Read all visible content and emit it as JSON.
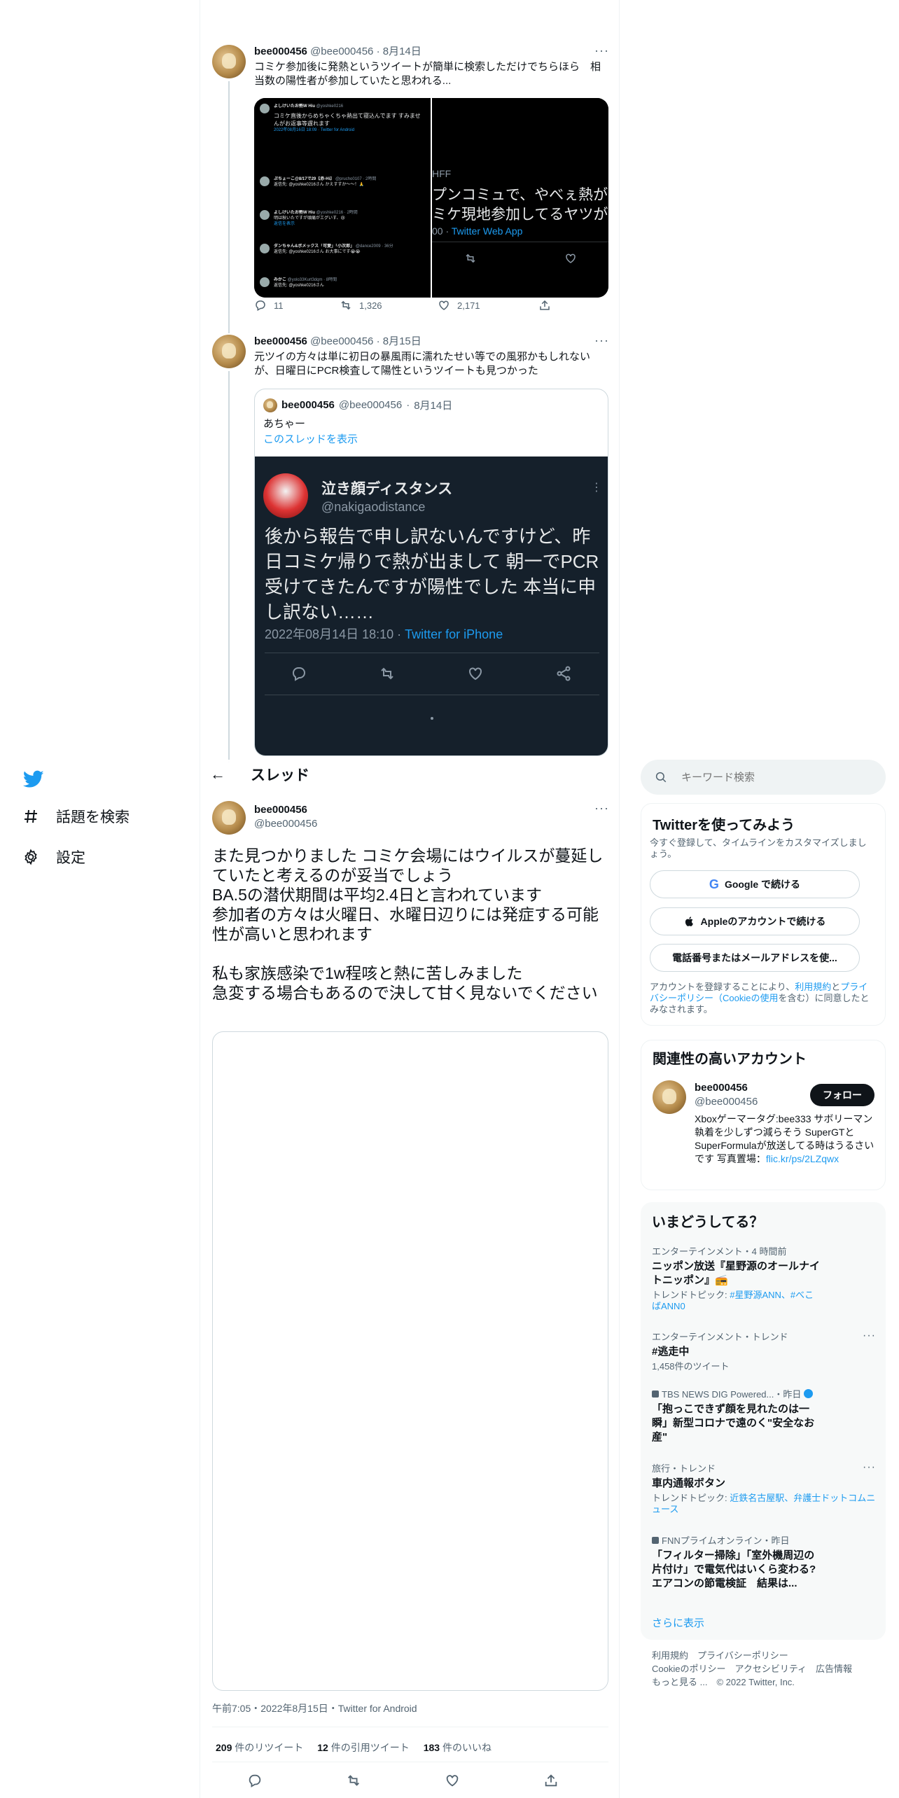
{
  "nav": {
    "explore_label": "話題を検索",
    "settings_label": "設定"
  },
  "header": {
    "back": "←",
    "title": "スレッド"
  },
  "tweets": [
    {
      "name": "bee000456",
      "handle": "@bee000456",
      "date": "8月14日",
      "text": "コミケ参加後に発熱というツイートが簡単に検索しただけでちらほら　相当数の陽性者が参加していたと思われる...",
      "replies": "11",
      "retweets": "1,326",
      "likes": "2,171",
      "media": {
        "left": {
          "rows": [
            {
              "name": "よしけいたお熱W Hiu",
              "handle": "@yoshke0216",
              "text": "コミケ直後からめちゃくちゃ熱出て寝込んでます すみませんがお返事等遅れます",
              "time": "2022年08月16日 18:09 · Twitter for Android"
            },
            {
              "name": "ぷちょーこ@8/17で29【赤-Hi】",
              "handle": "@prucho0107 · 2時間",
              "text": "返信先: @yoshke0216さん かえすすか〜〜！🙏",
              "time": ""
            },
            {
              "name": "よしけいたお熱W Hiu",
              "handle": "@yoshke0216 · 2時間",
              "text": "明は秋いたですが頭痛がエグいす、😢",
              "time": "返信を表示"
            },
            {
              "name": "ダンちゃん&ボメックス「可愛」「小次郎」",
              "handle": "@dance2009 · 36分",
              "text": "返信先: @yoshke0216さん お大事にです😭😭",
              "time": ""
            },
            {
              "name": "みかこ",
              "handle": "@yolo33Kurt3dqm · 8時間",
              "text": "返信先: @yoshke0216さん",
              "time": ""
            }
          ]
        },
        "right": {
          "lines": [
            "HFF",
            "プンコミュで、やべぇ熱が",
            "ミケ現地参加してるヤツがい"
          ],
          "footer_prefix": "00 · ",
          "footer_link": "Twitter Web App"
        }
      }
    },
    {
      "name": "bee000456",
      "handle": "@bee000456",
      "date": "8月15日",
      "text": "元ツイの方々は単に初日の暴風雨に濡れたせい等での風邪かもしれないが、日曜日にPCR検査して陽性というツイートも見つかった",
      "quote": {
        "name": "bee000456",
        "handle": "@bee000456",
        "date": "8月14日",
        "text": "あちゃー",
        "show_thread": "このスレッドを表示",
        "media": {
          "name": "泣き顔ディスタンス",
          "handle": "@nakigaodistance",
          "text": "後から報告で申し訳ないんですけど、昨日コミケ帰りで熱が出まして 朝一でPCR受けてきたんですが陽性でした 本当に申し訳ない……",
          "time": "2022年08月14日 18:10 · ",
          "client": "Twitter for iPhone"
        }
      }
    }
  ],
  "focus": {
    "name": "bee000456",
    "handle": "@bee000456",
    "text": "また見つかりました コミケ会場にはウイルスが蔓延していたと考えるのが妥当でしょう\nBA.5の潜伏期間は平均2.4日と言われています\n参加者の方々は火曜日、水曜日辺りには発症する可能性が高いと思われます\n\n私も家族感染で1w程咳と熱に苦しみました\n急変する場合もあるので決して甘く見ないでください",
    "timestamp": "午前7:05・2022年8月15日・Twitter for Android",
    "retweets_num": "209",
    "retweets_label": " 件のリツイート",
    "quotes_num": "12",
    "quotes_label": " 件の引用ツイート",
    "likes_num": "183",
    "likes_label": " 件のいいね"
  },
  "search": {
    "placeholder": "キーワード検索"
  },
  "signup": {
    "title": "Twitterを使ってみよう",
    "desc": "今すぐ登録して、タイムラインをカスタマイズしましょう。",
    "google": "Google で続ける",
    "apple": "Appleのアカウントで続ける",
    "phone": "電話番号またはメールアドレスを使...",
    "terms_pre": "アカウントを登録することにより、",
    "terms_link1": "利用規約",
    "terms_mid": "と",
    "terms_link2": "プライバシーポリシー（Cookieの使用",
    "terms_post": "を含む）に同意したとみなされます。"
  },
  "related": {
    "title": "関連性の高いアカウント",
    "name": "bee000456",
    "handle": "@bee000456",
    "follow": "フォロー",
    "bio": "Xboxゲーマータグ:bee333 サボリーマン 執着を少しずつ減らそう SuperGTとSuperFormulaが放送してる時はうるさいです 写真置場：",
    "bio_link": "flic.kr/ps/2LZqwx"
  },
  "trends": {
    "title": "いまどうしてる？",
    "items": [
      {
        "cat": "エンターテインメント・4 時間前",
        "title": "ニッポン放送『星野源のオールナイトニッポン』📻",
        "sub_pre": "トレンドトピック: ",
        "sub_link": "#星野源ANN、#べこばANN0"
      },
      {
        "cat": "エンターテインメント・トレンド",
        "title": "#逃走中",
        "sub_pre": "1,458件のツイート",
        "sub_link": ""
      },
      {
        "cat": "TBS NEWS DIG Powered...・昨日",
        "title": "「抱っこできず顔を見れたのは一瞬」新型コロナで遠のく\"安全なお産\"",
        "sub_pre": "",
        "sub_link": ""
      },
      {
        "cat": "旅行・トレンド",
        "title": "車内通報ボタン",
        "sub_pre": "トレンドトピック: ",
        "sub_link": "近鉄名古屋駅、弁護士ドットコムニュース"
      },
      {
        "cat": "FNNプライムオンライン・昨日",
        "title": "「フィルター掃除」「室外機周辺の片付け」で電気代はいくら変わる? エアコンの節電検証　結果は...",
        "sub_pre": "",
        "sub_link": ""
      }
    ],
    "show_more": "さらに表示"
  },
  "footer": {
    "line1": "利用規約　プライバシーポリシー",
    "line2": "Cookieのポリシー　アクセシビリティ　広告情報",
    "line3": "もっと見る ...　© 2022 Twitter, Inc."
  },
  "colors": {
    "accent": "#1d9bf0",
    "text": "#0f1419",
    "secondary": "#536471",
    "border": "#eff3f4"
  }
}
